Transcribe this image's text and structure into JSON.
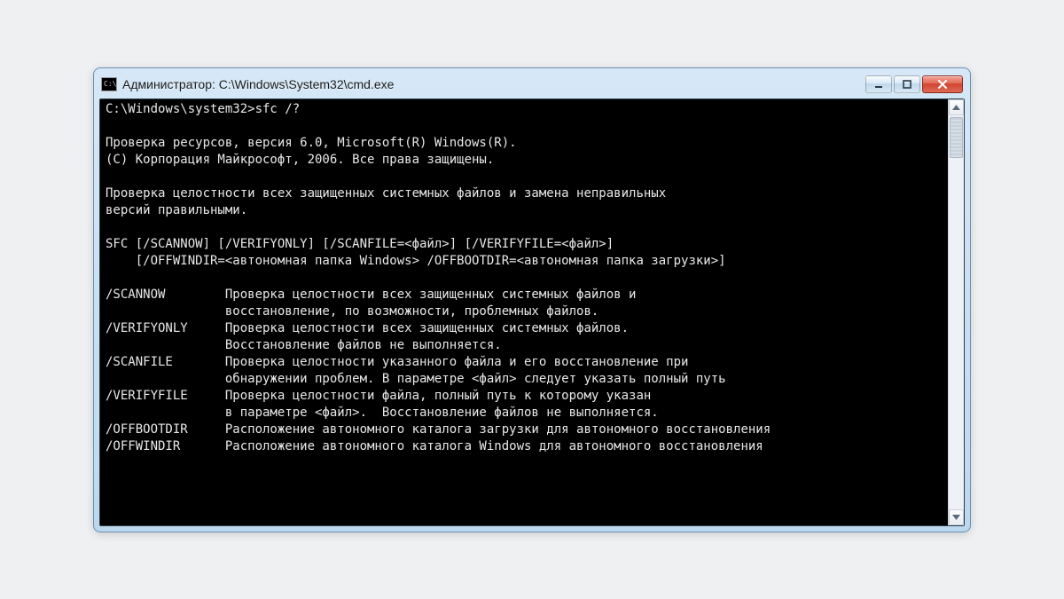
{
  "window": {
    "icon_text": "C:\\",
    "title": "Администратор: C:\\Windows\\System32\\cmd.exe"
  },
  "console_text": "C:\\Windows\\system32>sfc /?\n\nПроверка ресурсов, версия 6.0, Microsoft(R) Windows(R).\n(C) Корпорация Майкрософт, 2006. Все права защищены.\n\nПроверка целостности всех защищенных системных файлов и замена неправильных\nверсий правильными.\n\nSFC [/SCANNOW] [/VERIFYONLY] [/SCANFILE=<файл>] [/VERIFYFILE=<файл>]\n    [/OFFWINDIR=<автономная папка Windows> /OFFBOOTDIR=<автономная папка загрузки>]\n\n/SCANNOW        Проверка целостности всех защищенных системных файлов и\n                восстановление, по возможности, проблемных файлов.\n/VERIFYONLY     Проверка целостности всех защищенных системных файлов.\n                Восстановление файлов не выполняется.\n/SCANFILE       Проверка целостности указанного файла и его восстановление при\n                обнаружении проблем. В параметре <файл> следует указать полный путь\n/VERIFYFILE     Проверка целостности файла, полный путь к которому указан\n                в параметре <файл>.  Восстановление файлов не выполняется.\n/OFFBOOTDIR     Расположение автономного каталога загрузки для автономного восстановления\n/OFFWINDIR      Расположение автономного каталога Windows для автономного восстановления"
}
